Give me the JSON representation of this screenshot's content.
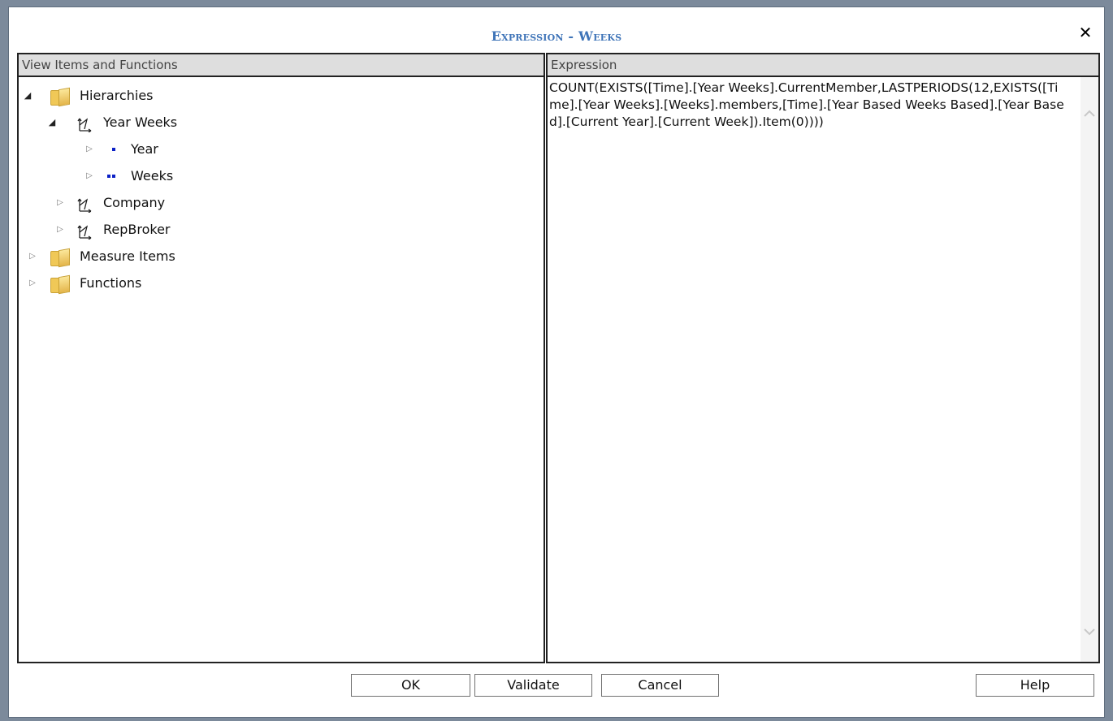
{
  "dialog": {
    "title": "Expression - Weeks",
    "close_glyph": "✕"
  },
  "left_panel": {
    "header": "View Items and Functions",
    "tree": {
      "hierarchies": "Hierarchies",
      "year_weeks": "Year Weeks",
      "year": "Year",
      "weeks": "Weeks",
      "company": "Company",
      "repbroker": "RepBroker",
      "measure_items": "Measure Items",
      "functions": "Functions"
    }
  },
  "right_panel": {
    "header": "Expression",
    "expression": "COUNT(EXISTS([Time].[Year Weeks].CurrentMember,LASTPERIODS(12,EXISTS([Time].[Year Weeks].[Weeks].members,[Time].[Year Based Weeks Based].[Year Based].[Current Year].[Current Week]).Item(0))))"
  },
  "footer": {
    "ok": "OK",
    "validate": "Validate",
    "cancel": "Cancel",
    "help": "Help"
  },
  "colors": {
    "title": "#3f74b8",
    "panel_header": "#dedede",
    "backdrop": "#7c8a9b",
    "level_marker": "#0b20c6"
  },
  "icons": {
    "folder": "folder-icon",
    "hierarchy": "hierarchy-icon",
    "expanded": "expanded-arrow-icon",
    "collapsed": "collapsed-arrow-icon",
    "level": "level-icon"
  }
}
